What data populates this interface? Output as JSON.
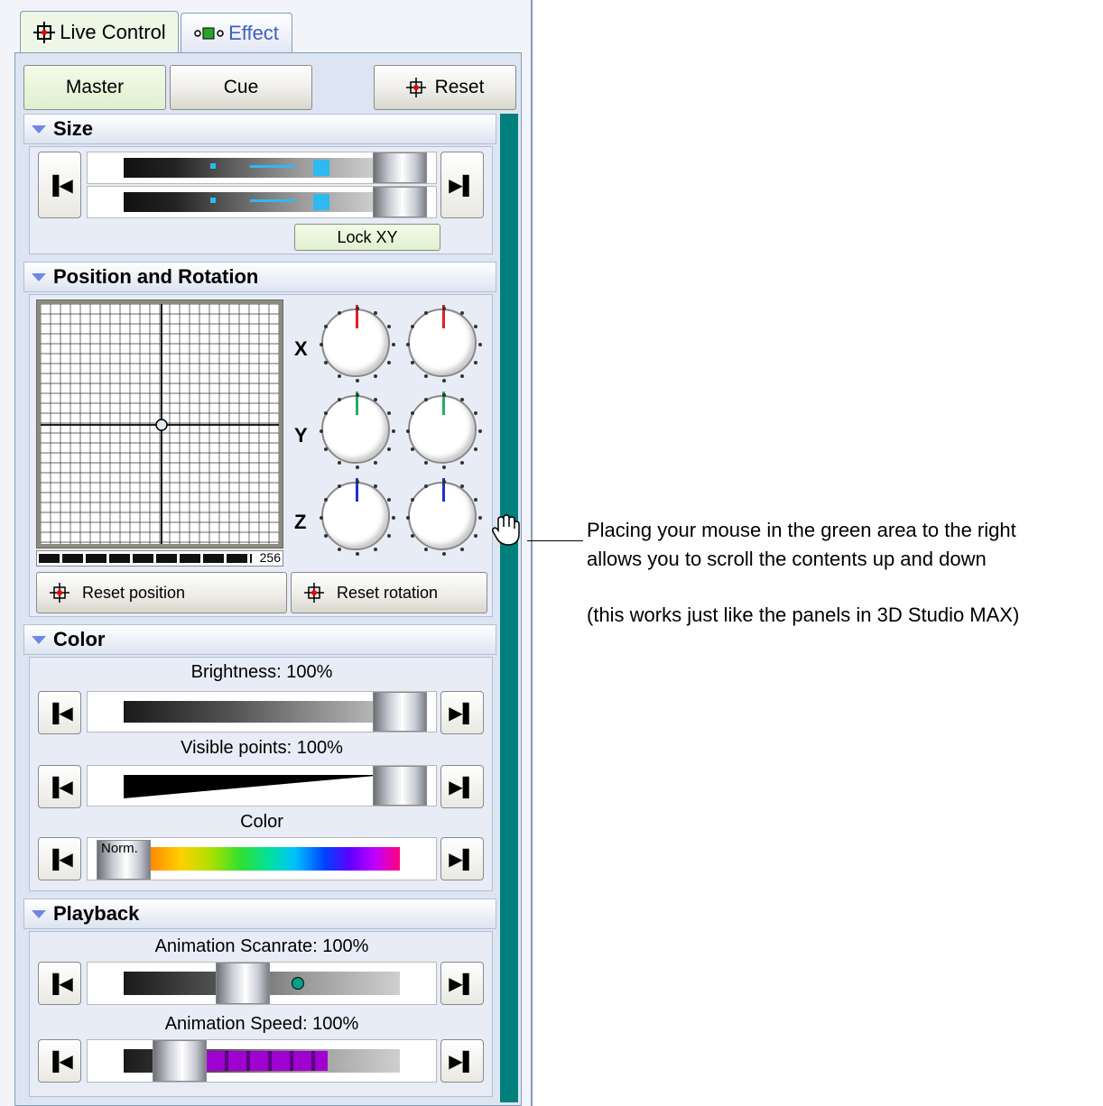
{
  "tabs": [
    {
      "label": "Live Control",
      "icon": "crosshair-icon"
    },
    {
      "label": "Effect",
      "icon": "effect-icon"
    }
  ],
  "modes": {
    "master": "Master",
    "cue": "Cue",
    "reset": "Reset"
  },
  "sections": {
    "size": "Size",
    "position": "Position and Rotation",
    "color": "Color",
    "playback": "Playback"
  },
  "size": {
    "lock_xy": "Lock XY"
  },
  "position": {
    "counter": "256",
    "axes": [
      "X",
      "Y",
      "Z"
    ],
    "reset_position": "Reset position",
    "reset_rotation": "Reset rotation",
    "axis_colors": {
      "x": "#e02020",
      "y": "#20b060",
      "z": "#2030d0"
    }
  },
  "color": {
    "brightness_label": "Brightness: 100%",
    "visible_label": "Visible points: 100%",
    "color_label": "Color",
    "norm_label": "Norm."
  },
  "playback": {
    "scanrate_label": "Animation Scanrate: 100%",
    "speed_label": "Animation Speed: 100%"
  },
  "annotation": {
    "line1": "Placing your mouse in the green area to the right",
    "line2": "allows you to scroll the contents up and down",
    "line3": "(this works just like the panels in 3D Studio MAX)"
  },
  "colors": {
    "scroll_area": "#007f7d",
    "accent_green": "#eef6e6"
  }
}
